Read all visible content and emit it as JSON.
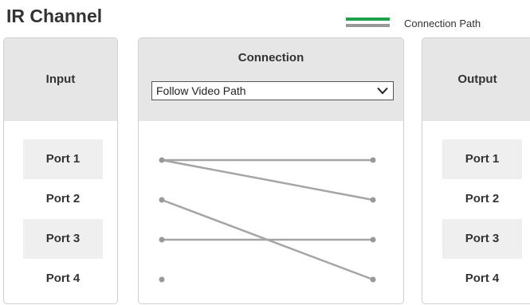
{
  "title": "IR Channel",
  "legend": {
    "label": "Connection Path",
    "green_color": "#1fa04a",
    "gray_color": "#999999"
  },
  "input": {
    "header": "Input",
    "ports": [
      "Port 1",
      "Port 2",
      "Port 3",
      "Port 4"
    ]
  },
  "connection": {
    "header": "Connection",
    "dropdown_value": "Follow Video Path",
    "dropdown_icon": "chevron-down-icon",
    "links": [
      {
        "from": 1,
        "to": 1
      },
      {
        "from": 1,
        "to": 2
      },
      {
        "from": 2,
        "to": 4
      },
      {
        "from": 3,
        "to": 3
      }
    ],
    "line_color": "#a5a5a5",
    "dot_color": "#999999"
  },
  "output": {
    "header": "Output",
    "ports": [
      "Port 1",
      "Port 2",
      "Port 3",
      "Port 4"
    ]
  }
}
